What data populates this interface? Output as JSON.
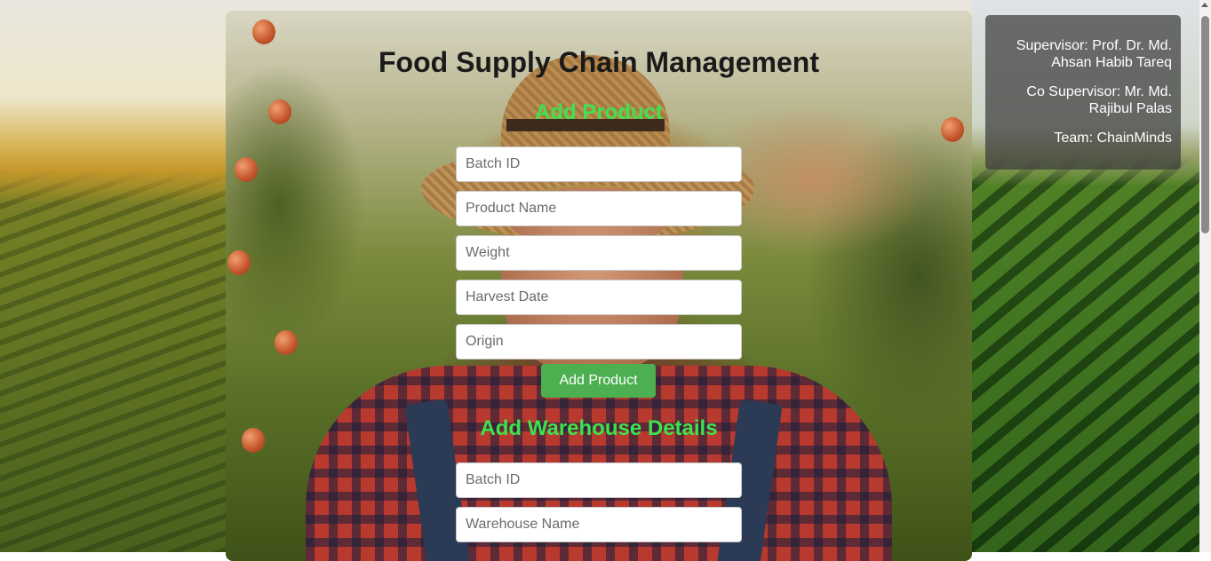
{
  "title": "Food Supply Chain Management",
  "add_product": {
    "heading": "Add Product",
    "fields": [
      {
        "placeholder": "Batch ID",
        "value": ""
      },
      {
        "placeholder": "Product Name",
        "value": ""
      },
      {
        "placeholder": "Weight",
        "value": ""
      },
      {
        "placeholder": "Harvest Date",
        "value": ""
      },
      {
        "placeholder": "Origin",
        "value": ""
      }
    ],
    "button_label": "Add Product"
  },
  "add_warehouse": {
    "heading": "Add Warehouse Details",
    "fields": [
      {
        "placeholder": "Batch ID",
        "value": ""
      },
      {
        "placeholder": "Warehouse Name",
        "value": ""
      }
    ]
  },
  "info_panel": {
    "supervisor": "Supervisor: Prof. Dr. Md. Ahsan Habib Tareq",
    "co_supervisor": "Co Supervisor: Mr. Md. Rajibul Palas",
    "team": "Team: ChainMinds"
  },
  "colors": {
    "section_heading": "#3ee24e",
    "button_bg": "#4caf50",
    "title_text": "#1a1a1a",
    "panel_bg": "rgba(60,60,60,0.72)"
  }
}
